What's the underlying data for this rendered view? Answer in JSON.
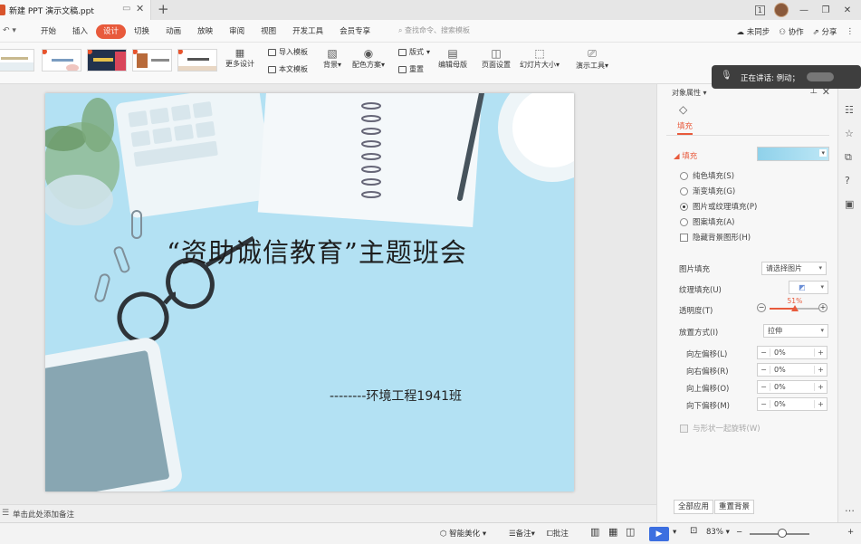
{
  "titlebar": {
    "doc_tab": "新建 PPT 演示文稿.ppt",
    "add_tab": "+",
    "page_badge": "1",
    "minimize": "—",
    "restore": "❐",
    "close": "✕"
  },
  "menu": {
    "items": [
      "开始",
      "插入",
      "设计",
      "切换",
      "动画",
      "放映",
      "审阅",
      "视图",
      "开发工具",
      "会员专享"
    ],
    "active_index": 2,
    "search_placeholder": "查找命令、搜索模板",
    "right": {
      "sync": "未同步",
      "collab": "协作",
      "share": "分享"
    }
  },
  "ribbon": {
    "more_design": "更多设计",
    "import_template": "导入模板",
    "text_template": "本文模板",
    "background": "背景",
    "color_scheme": "配色方案",
    "layout": "版式",
    "reset": "重置",
    "edit_master": "编辑母版",
    "page_setup": "页面设置",
    "slide_size": "幻灯片大小",
    "presentation_tools": "演示工具"
  },
  "speaking": {
    "label": "正在讲话: 例动；"
  },
  "slide": {
    "title": "“资助诚信教育”主题班会",
    "subtitle": "--------环境工程1941班"
  },
  "notes": {
    "placeholder": "单击此处添加备注"
  },
  "panel": {
    "title": "对象属性",
    "tab_fill": "填充",
    "section_fill": "填充",
    "options": [
      {
        "label": "纯色填充(S)",
        "selected": false
      },
      {
        "label": "渐变填充(G)",
        "selected": false
      },
      {
        "label": "图片或纹理填充(P)",
        "selected": true
      },
      {
        "label": "图案填充(A)",
        "selected": false
      }
    ],
    "hide_bg": "隐藏背景图形(H)",
    "picture_fill_label": "图片填充",
    "picture_fill_value": "请选择图片",
    "texture_fill_label": "纹理填充(U)",
    "transparency_label": "透明度(T)",
    "transparency_value": "51%",
    "transparency_fraction": 0.51,
    "placement_label": "放置方式(I)",
    "placement_value": "拉伸",
    "offsets": [
      {
        "label": "向左偏移(L)",
        "value": "0%"
      },
      {
        "label": "向右偏移(R)",
        "value": "0%"
      },
      {
        "label": "向上偏移(O)",
        "value": "0%"
      },
      {
        "label": "向下偏移(M)",
        "value": "0%"
      }
    ],
    "rotate_with_shape": "与形状一起旋转(W)",
    "apply_all": "全部应用",
    "reset_bg": "重置背景"
  },
  "statusbar": {
    "smart_beautify": "智能美化",
    "notes": "备注",
    "comments": "批注",
    "zoom": "83%",
    "zoom_fraction": 0.55
  },
  "colors": {
    "accent": "#e85a3c",
    "slide_bg": "#b3e1f3",
    "play": "#3c6fe0"
  }
}
